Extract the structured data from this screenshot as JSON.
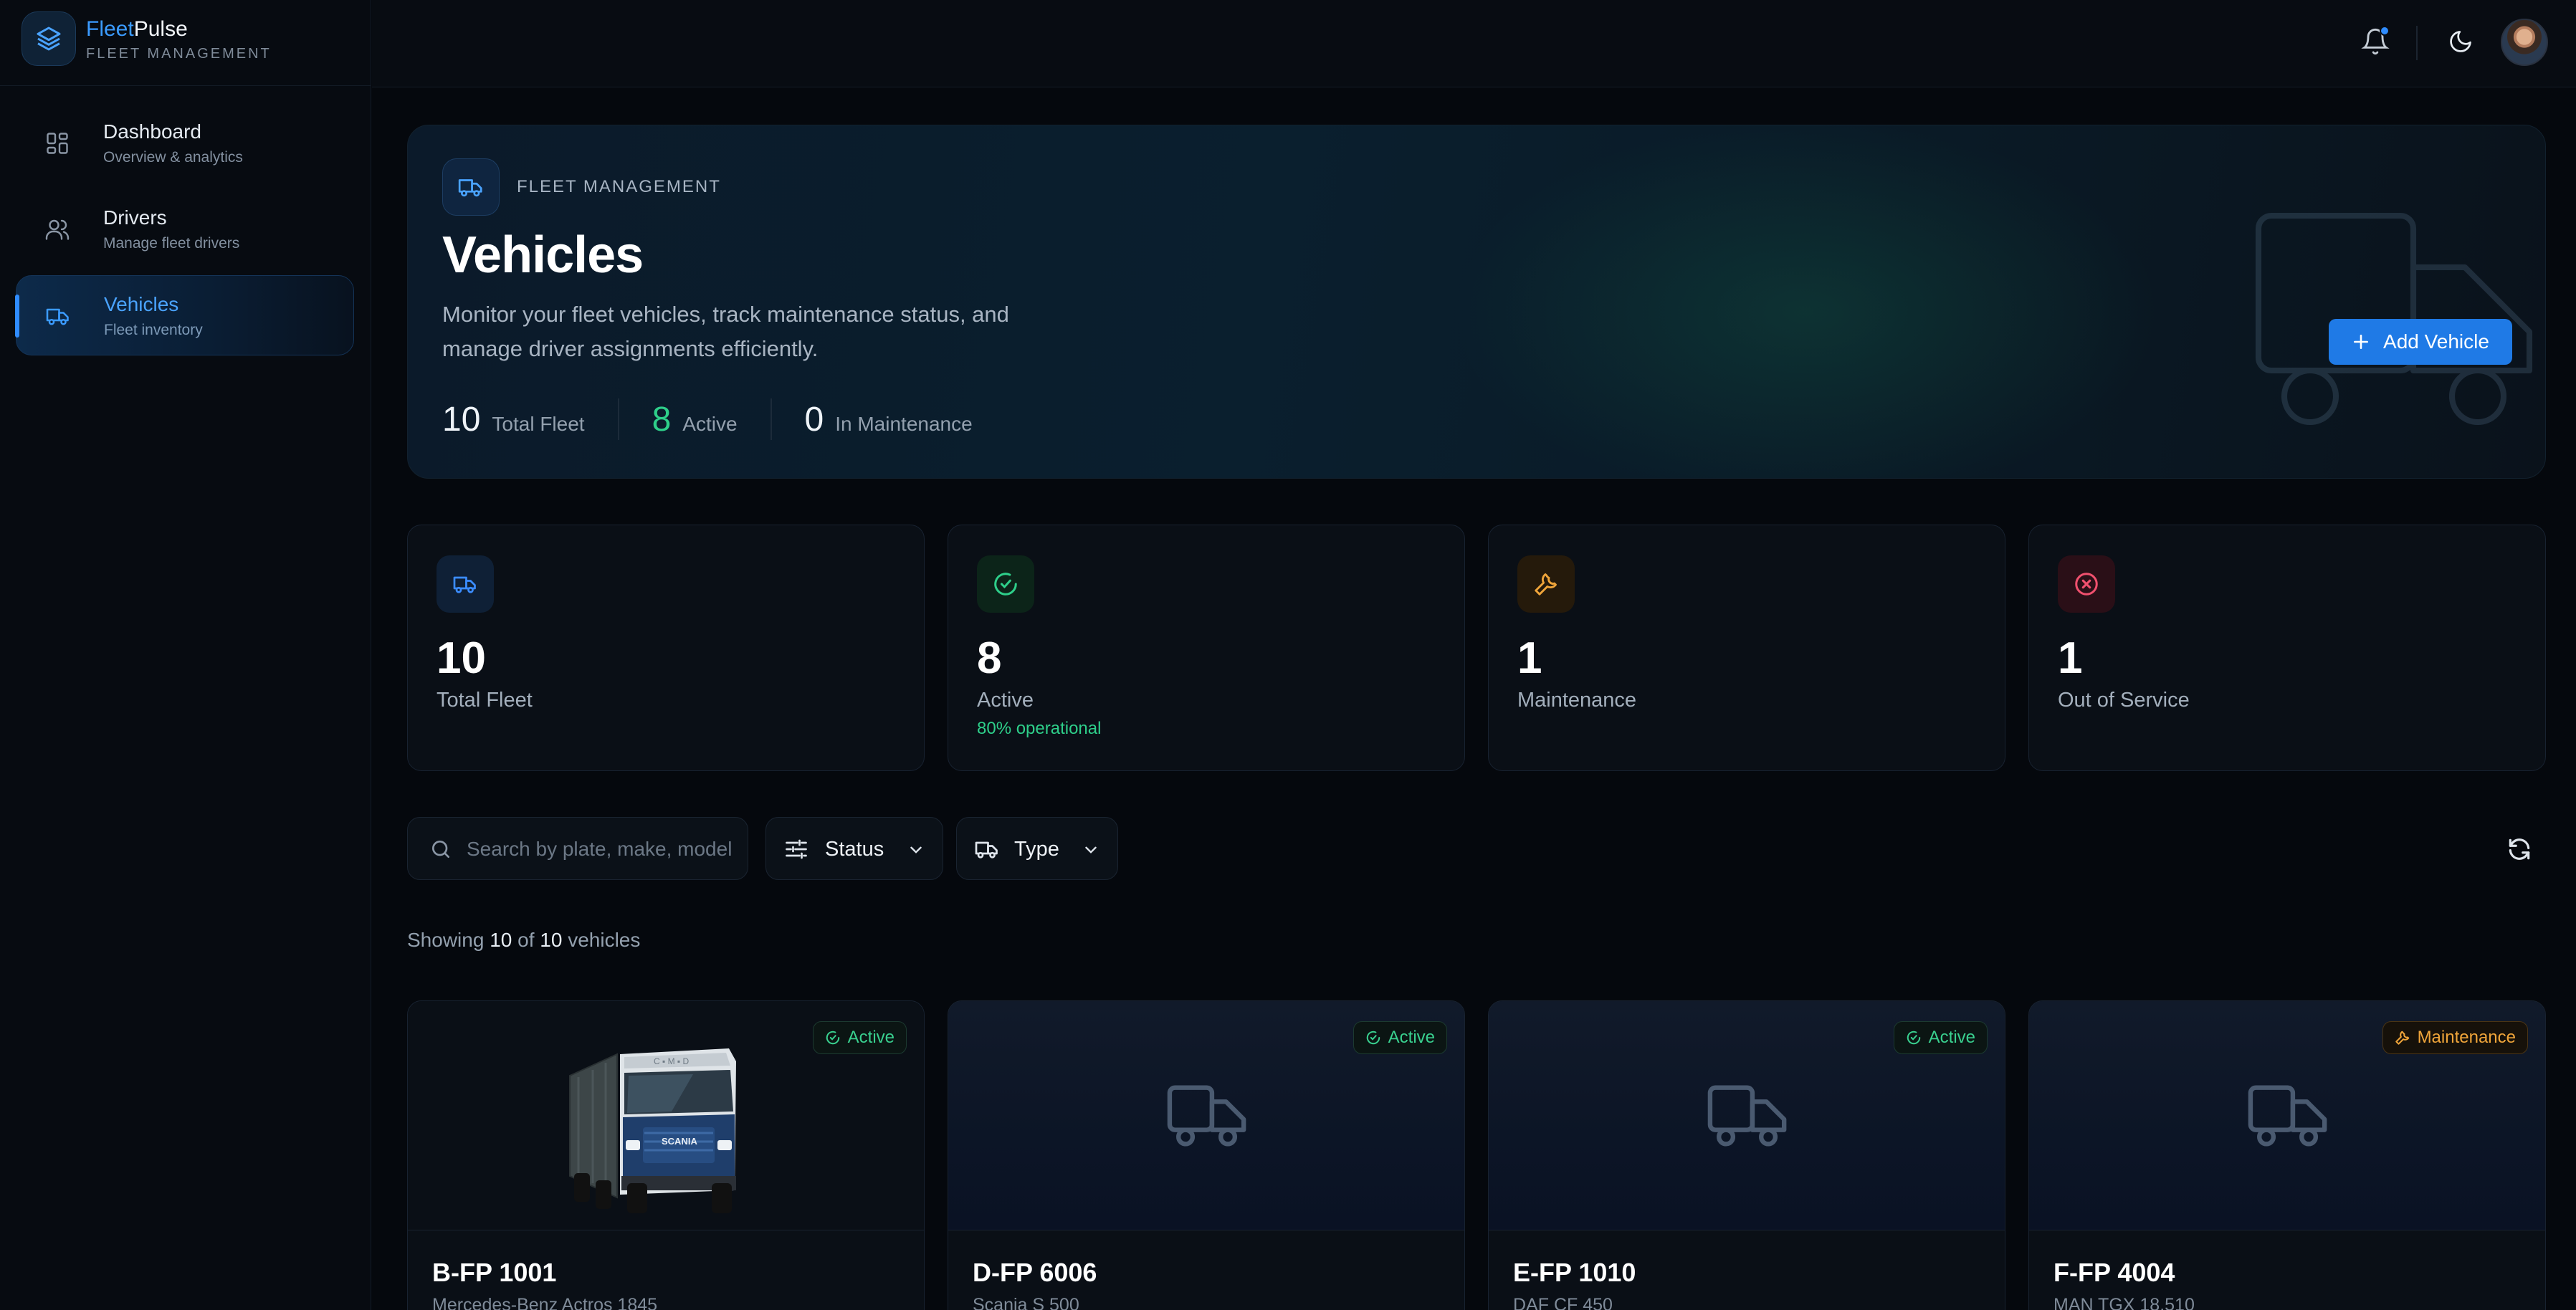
{
  "brand": {
    "name_accent": "Fleet",
    "name_rest": "Pulse",
    "subtitle": "FLEET MANAGEMENT",
    "logo_icon": "layers-icon"
  },
  "nav": {
    "items": [
      {
        "label": "Dashboard",
        "sub": "Overview & analytics",
        "icon": "dashboard-grid-icon",
        "active": false
      },
      {
        "label": "Drivers",
        "sub": "Manage fleet drivers",
        "icon": "users-icon",
        "active": false
      },
      {
        "label": "Vehicles",
        "sub": "Fleet inventory",
        "icon": "truck-icon",
        "active": true
      }
    ]
  },
  "topbar": {
    "icons": [
      "bell-icon",
      "moon-icon",
      "avatar"
    ],
    "notification_color": "#2f8cff"
  },
  "hero": {
    "eyebrow": "FLEET MANAGEMENT",
    "title": "Vehicles",
    "description": "Monitor your fleet vehicles, track maintenance status, and manage driver assignments efficiently.",
    "stats": [
      {
        "value": "10",
        "label": "Total Fleet"
      },
      {
        "value": "8",
        "label": "Active"
      },
      {
        "value": "0",
        "label": "In Maintenance"
      }
    ],
    "add_button": "Add Vehicle"
  },
  "stat_cards": [
    {
      "value": "10",
      "label": "Total Fleet",
      "sub": "",
      "icon": "truck-icon",
      "color": "#3b8cff"
    },
    {
      "value": "8",
      "label": "Active",
      "sub": "80% operational",
      "icon": "check-circle-icon",
      "color": "#2ecf8a"
    },
    {
      "value": "1",
      "label": "Maintenance",
      "sub": "",
      "icon": "wrench-icon",
      "color": "#f0a53a"
    },
    {
      "value": "1",
      "label": "Out of Service",
      "sub": "",
      "icon": "x-circle-icon",
      "color": "#f0506e"
    }
  ],
  "filters": {
    "search_placeholder": "Search by plate, make, model...",
    "status_label": "Status",
    "type_label": "Type"
  },
  "showing": {
    "prefix": "Showing",
    "shown": "10",
    "of": "of",
    "total": "10",
    "suffix": "vehicles"
  },
  "vehicles": [
    {
      "plate": "B-FP 1001",
      "model": "Mercedes-Benz Actros 1845",
      "status": "Active",
      "has_photo": true
    },
    {
      "plate": "D-FP 6006",
      "model": "Scania S 500",
      "status": "Active",
      "has_photo": false
    },
    {
      "plate": "E-FP 1010",
      "model": "DAF CF 450",
      "status": "Active",
      "has_photo": false
    },
    {
      "plate": "F-FP 4004",
      "model": "MAN TGX 18.510",
      "status": "Maintenance",
      "has_photo": false
    }
  ]
}
